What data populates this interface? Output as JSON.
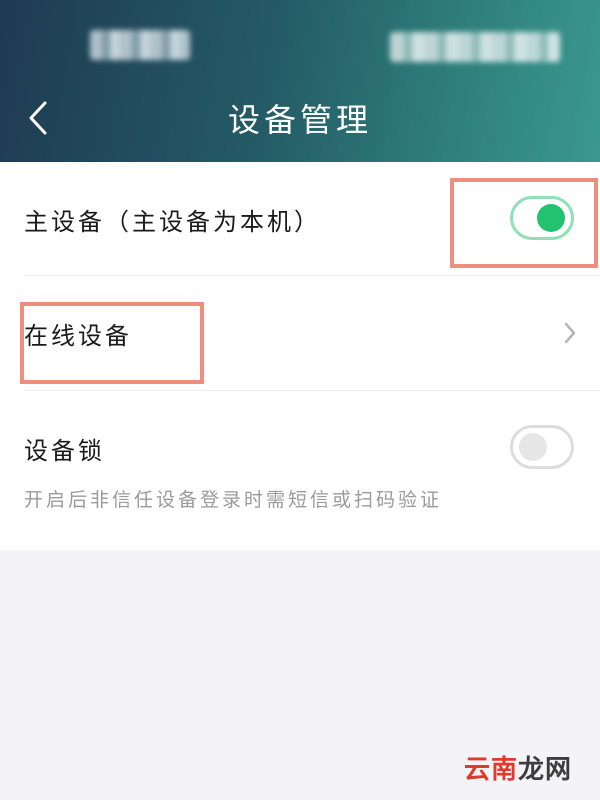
{
  "header": {
    "title": "设备管理",
    "back_icon": "chevron-left-icon"
  },
  "rows": {
    "primary_device": {
      "label": "主设备（主设备为本机）",
      "toggle_on": true
    },
    "online_devices": {
      "label": "在线设备",
      "chevron_icon": "chevron-right-icon"
    },
    "device_lock": {
      "label": "设备锁",
      "toggle_on": false,
      "hint": "开启后非信任设备登录时需短信或扫码验证"
    }
  },
  "colors": {
    "header_start": "#1f3a52",
    "header_end": "#3b9890",
    "toggle_on": "#22c270",
    "highlight": "#ee8f7d"
  },
  "watermark": {
    "part1": "云南",
    "part2": "龙网"
  }
}
